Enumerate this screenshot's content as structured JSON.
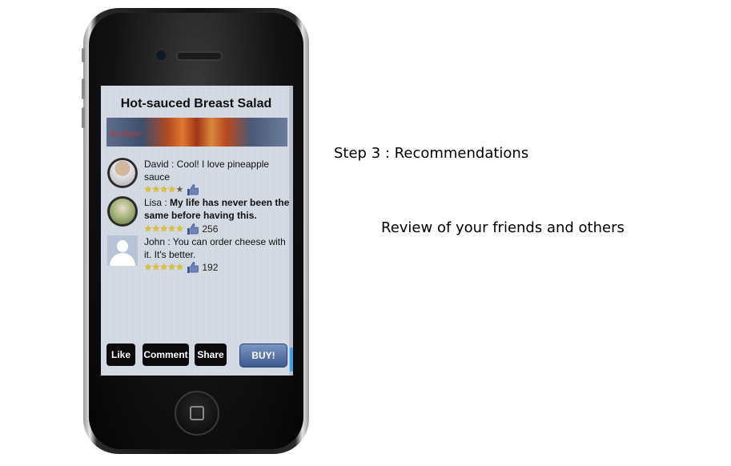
{
  "screen": {
    "title": "Hot-sauced Breast Salad",
    "banner_text": "By Kiyeo",
    "reviews": [
      {
        "name": "David",
        "text_normal": "David : Cool! I love pineapple sauce",
        "text_bold": "",
        "stars": 4,
        "likes": ""
      },
      {
        "name": "Lisa",
        "text_normal": "Lisa : ",
        "text_bold": "My life has never been the same before having this.",
        "stars": 5,
        "likes": "256"
      },
      {
        "name": "John",
        "text_normal": "John : You can order cheese with it. It's better.",
        "text_bold": "",
        "stars": 5,
        "likes": "192"
      }
    ],
    "buttons": {
      "like": "Like",
      "comment": "Comment",
      "share": "Share",
      "buy": "BUY!"
    }
  },
  "captions": {
    "step": "Step 3 : Recommendations",
    "subtitle": "Review of your friends and others"
  },
  "colors": {
    "star": "#e8c21a",
    "buy_button": "#4a6a9e",
    "scroll_indicator": "#3aa0e8"
  }
}
